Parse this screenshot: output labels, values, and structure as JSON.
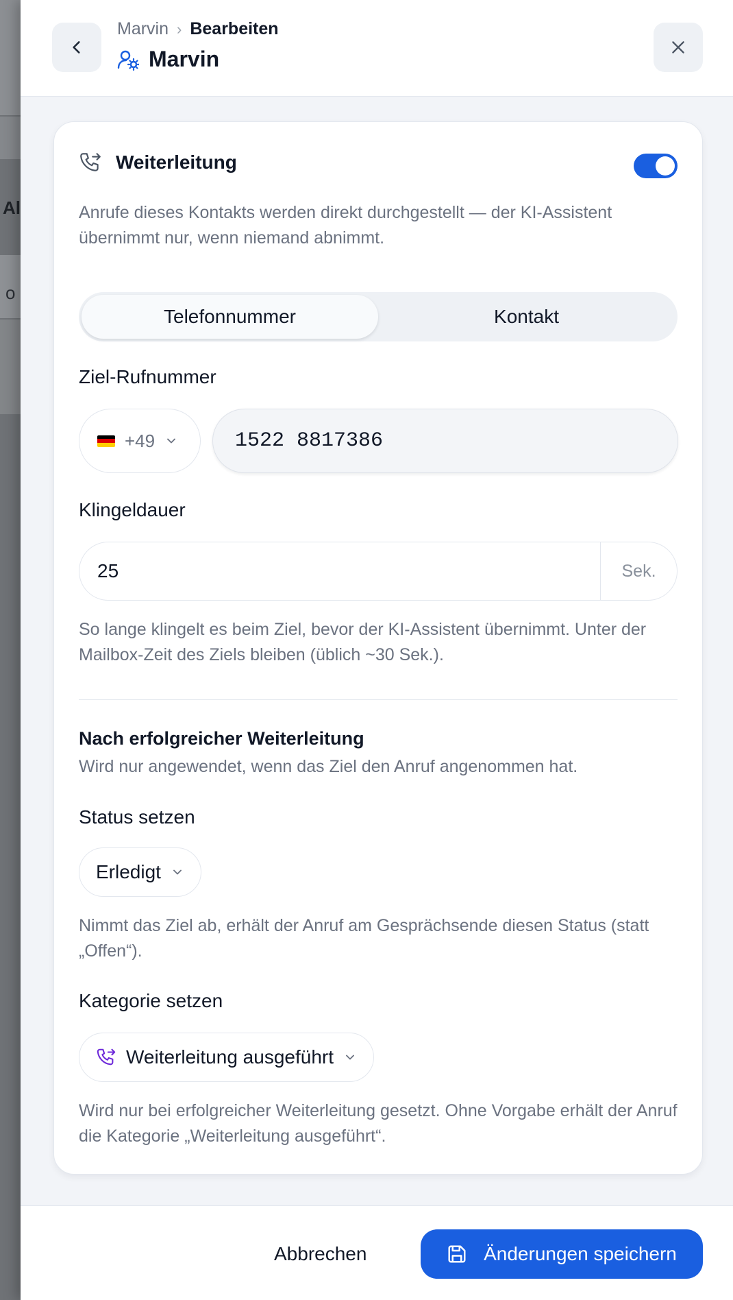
{
  "header": {
    "breadcrumb_parent": "Marvin",
    "breadcrumb_current": "Bearbeiten",
    "title": "Marvin"
  },
  "background": {
    "fragment_a": "Al",
    "fragment_b": "o"
  },
  "forwarding": {
    "title": "Weiterleitung",
    "enabled": true,
    "description": "Anrufe dieses Kontakts werden direkt durchgestellt — der KI-Assistent übernimmt nur, wenn niemand abnimmt.",
    "tabs": [
      {
        "label": "Telefonnummer",
        "active": true
      },
      {
        "label": "Kontakt",
        "active": false
      }
    ],
    "target_label": "Ziel-Rufnummer",
    "country_code": "+49",
    "country_flag": "de",
    "phone_value": "1522 8817386",
    "ring_label": "Klingeldauer",
    "ring_value": "25",
    "ring_unit": "Sek.",
    "ring_help": "So lange klingelt es beim Ziel, bevor der KI-Assistent übernimmt. Unter der Mailbox-Zeit des Ziels bleiben (üblich ~30 Sek.)."
  },
  "after_success": {
    "title": "Nach erfolgreicher Weiterleitung",
    "subtitle": "Wird nur angewendet, wenn das Ziel den Anruf angenommen hat.",
    "status_label": "Status setzen",
    "status_value": "Erledigt",
    "status_help": "Nimmt das Ziel ab, erhält der Anruf am Gesprächsende diesen Status (statt „Offen“).",
    "category_label": "Kategorie setzen",
    "category_value": "Weiterleitung ausgeführt",
    "category_help": "Wird nur bei erfolgreicher Weiterleitung gesetzt. Ohne Vorgabe erhält der Anruf die Kategorie „Weiterleitung ausgeführt“."
  },
  "footer": {
    "cancel_label": "Abbrechen",
    "save_label": "Änderungen speichern"
  },
  "colors": {
    "accent": "#1a5fe0",
    "category_icon": "#6d28d9",
    "muted_text": "#6b7280"
  }
}
